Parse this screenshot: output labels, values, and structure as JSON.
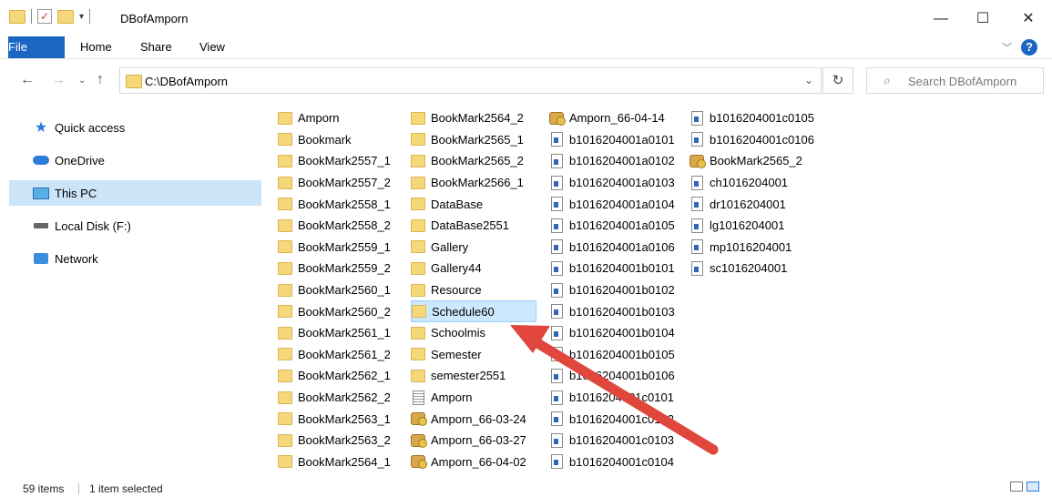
{
  "window": {
    "title": "DBofAmporn",
    "minimize": "—",
    "maximize": "☐",
    "close": "✕"
  },
  "ribbon": {
    "tabs": [
      "File",
      "Home",
      "Share",
      "View"
    ],
    "help": "?"
  },
  "address": {
    "path": "C:\\DBofAmporn",
    "search_placeholder": "Search DBofAmporn"
  },
  "sidebar": {
    "items": [
      {
        "label": "Quick access",
        "icon": "star-icon"
      },
      {
        "label": "OneDrive",
        "icon": "cloud-icon"
      },
      {
        "label": "This PC",
        "icon": "computer-icon"
      },
      {
        "label": "Local Disk (F:)",
        "icon": "drive-icon"
      },
      {
        "label": "Network",
        "icon": "network-icon"
      }
    ]
  },
  "files": {
    "columns": [
      [
        {
          "name": "Amporn",
          "type": "folder"
        },
        {
          "name": "Bookmark",
          "type": "folder"
        },
        {
          "name": "BookMark2557_1",
          "type": "folder"
        },
        {
          "name": "BookMark2557_2",
          "type": "folder"
        },
        {
          "name": "BookMark2558_1",
          "type": "folder"
        },
        {
          "name": "BookMark2558_2",
          "type": "folder"
        },
        {
          "name": "BookMark2559_1",
          "type": "folder"
        },
        {
          "name": "BookMark2559_2",
          "type": "folder"
        },
        {
          "name": "BookMark2560_1",
          "type": "folder"
        },
        {
          "name": "BookMark2560_2",
          "type": "folder"
        },
        {
          "name": "BookMark2561_1",
          "type": "folder"
        },
        {
          "name": "BookMark2561_2",
          "type": "folder"
        },
        {
          "name": "BookMark2562_1",
          "type": "folder"
        },
        {
          "name": "BookMark2562_2",
          "type": "folder"
        },
        {
          "name": "BookMark2563_1",
          "type": "folder"
        },
        {
          "name": "BookMark2563_2",
          "type": "folder"
        },
        {
          "name": "BookMark2564_1",
          "type": "folder"
        }
      ],
      [
        {
          "name": "BookMark2564_2",
          "type": "folder"
        },
        {
          "name": "BookMark2565_1",
          "type": "folder"
        },
        {
          "name": "BookMark2565_2",
          "type": "folder"
        },
        {
          "name": "BookMark2566_1",
          "type": "folder"
        },
        {
          "name": "DataBase",
          "type": "folder"
        },
        {
          "name": "DataBase2551",
          "type": "folder"
        },
        {
          "name": "Gallery",
          "type": "folder"
        },
        {
          "name": "Gallery44",
          "type": "folder"
        },
        {
          "name": "Resource",
          "type": "folder"
        },
        {
          "name": "Schedule60",
          "type": "folder",
          "selected": true
        },
        {
          "name": "Schoolmis",
          "type": "folder"
        },
        {
          "name": "Semester",
          "type": "folder"
        },
        {
          "name": "semester2551",
          "type": "folder"
        },
        {
          "name": "Amporn",
          "type": "txt"
        },
        {
          "name": "Amporn_66-03-24",
          "type": "db"
        },
        {
          "name": "Amporn_66-03-27",
          "type": "db"
        },
        {
          "name": "Amporn_66-04-02",
          "type": "db"
        }
      ],
      [
        {
          "name": "Amporn_66-04-14",
          "type": "db"
        },
        {
          "name": "b1016204001a0101",
          "type": "doc"
        },
        {
          "name": "b1016204001a0102",
          "type": "doc"
        },
        {
          "name": "b1016204001a0103",
          "type": "doc"
        },
        {
          "name": "b1016204001a0104",
          "type": "doc"
        },
        {
          "name": "b1016204001a0105",
          "type": "doc"
        },
        {
          "name": "b1016204001a0106",
          "type": "doc"
        },
        {
          "name": "b1016204001b0101",
          "type": "doc"
        },
        {
          "name": "b1016204001b0102",
          "type": "doc"
        },
        {
          "name": "b1016204001b0103",
          "type": "doc"
        },
        {
          "name": "b1016204001b0104",
          "type": "doc"
        },
        {
          "name": "b1016204001b0105",
          "type": "doc"
        },
        {
          "name": "b1016204001b0106",
          "type": "doc"
        },
        {
          "name": "b1016204001c0101",
          "type": "doc"
        },
        {
          "name": "b1016204001c0102",
          "type": "doc"
        },
        {
          "name": "b1016204001c0103",
          "type": "doc"
        },
        {
          "name": "b1016204001c0104",
          "type": "doc"
        }
      ],
      [
        {
          "name": "b1016204001c0105",
          "type": "doc"
        },
        {
          "name": "b1016204001c0106",
          "type": "doc"
        },
        {
          "name": "BookMark2565_2",
          "type": "db"
        },
        {
          "name": "ch1016204001",
          "type": "doc"
        },
        {
          "name": "dr1016204001",
          "type": "doc"
        },
        {
          "name": "lg1016204001",
          "type": "doc"
        },
        {
          "name": "mp1016204001",
          "type": "doc"
        },
        {
          "name": "sc1016204001",
          "type": "doc"
        }
      ]
    ]
  },
  "status": {
    "item_count": "59 items",
    "selected": "1 item selected"
  },
  "colors": {
    "accent": "#1a66c2",
    "selection": "#cce8ff",
    "annotation_arrow": "#e0463c"
  }
}
